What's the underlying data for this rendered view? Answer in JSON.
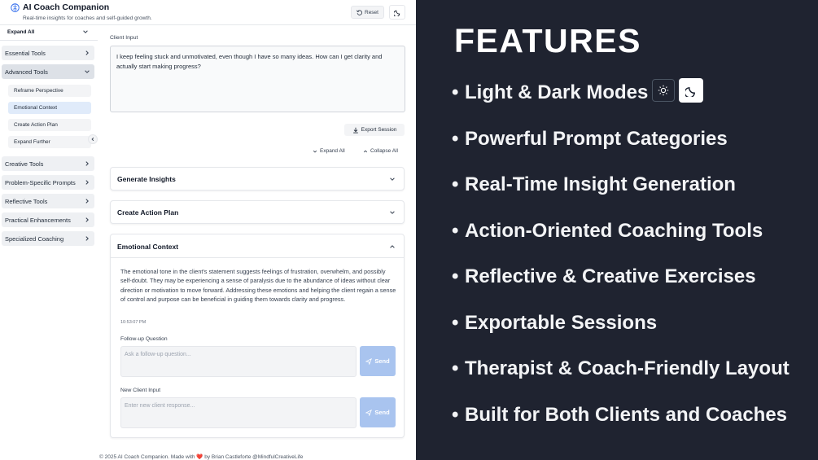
{
  "app": {
    "title": "AI Coach Companion",
    "subtitle": "Real-time insights for coaches and self-guided growth.",
    "reset_label": "Reset"
  },
  "sidebar": {
    "expand_all": "Expand All",
    "categories": [
      {
        "label": "Essential Tools"
      },
      {
        "label": "Advanced Tools"
      },
      {
        "label": "Creative Tools"
      },
      {
        "label": "Problem-Specific Prompts"
      },
      {
        "label": "Reflective Tools"
      },
      {
        "label": "Practical Enhancements"
      },
      {
        "label": "Specialized Coaching"
      }
    ],
    "advanced_items": [
      {
        "label": "Reframe Perspective"
      },
      {
        "label": "Emotional Context"
      },
      {
        "label": "Create Action Plan"
      },
      {
        "label": "Expand Further"
      }
    ]
  },
  "main": {
    "client_input_label": "Client Input",
    "client_input_value": "I keep feeling stuck and unmotivated, even though I have so many ideas. How can I get clarity and actually start making progress?",
    "export_label": "Export Session",
    "expand_all_label": "Expand All",
    "collapse_all_label": "Collapse All",
    "cards": [
      {
        "title": "Generate Insights"
      },
      {
        "title": "Create Action Plan"
      },
      {
        "title": "Emotional Context"
      }
    ],
    "emotional": {
      "text": "The emotional tone in the client's statement suggests feelings of frustration, overwhelm, and possibly self-doubt. They may be experiencing a sense of paralysis due to the abundance of ideas without clear direction or motivation to move forward. Addressing these emotions and helping the client regain a sense of control and purpose can be beneficial in guiding them towards clarity and progress.",
      "timestamp": "10:53:07 PM",
      "followup_label": "Follow-up Question",
      "followup_placeholder": "Ask a follow-up question...",
      "new_input_label": "New Client Input",
      "new_input_placeholder": "Enter new client response...",
      "send_label": "Send"
    },
    "footer": "© 2025 AI Coach Companion. Made with ❤️ by Brian Castleforte @MindfulCreativeLife"
  },
  "features": {
    "title": "FEATURES",
    "items": [
      {
        "label": "Light & Dark Modes"
      },
      {
        "label": "Powerful Prompt Categories"
      },
      {
        "label": "Real-Time Insight Generation"
      },
      {
        "label": "Action-Oriented Coaching Tools"
      },
      {
        "label": "Reflective & Creative Exercises"
      },
      {
        "label": "Exportable Sessions"
      },
      {
        "label": "Therapist & Coach-Friendly Layout"
      },
      {
        "label": "Built for Both Clients and Coaches"
      }
    ]
  },
  "colors": {
    "features_bg": "#1f2330",
    "send_button": "#a9c4ef",
    "active_item": "#e0ebfa",
    "logo_blue": "#2563eb"
  }
}
